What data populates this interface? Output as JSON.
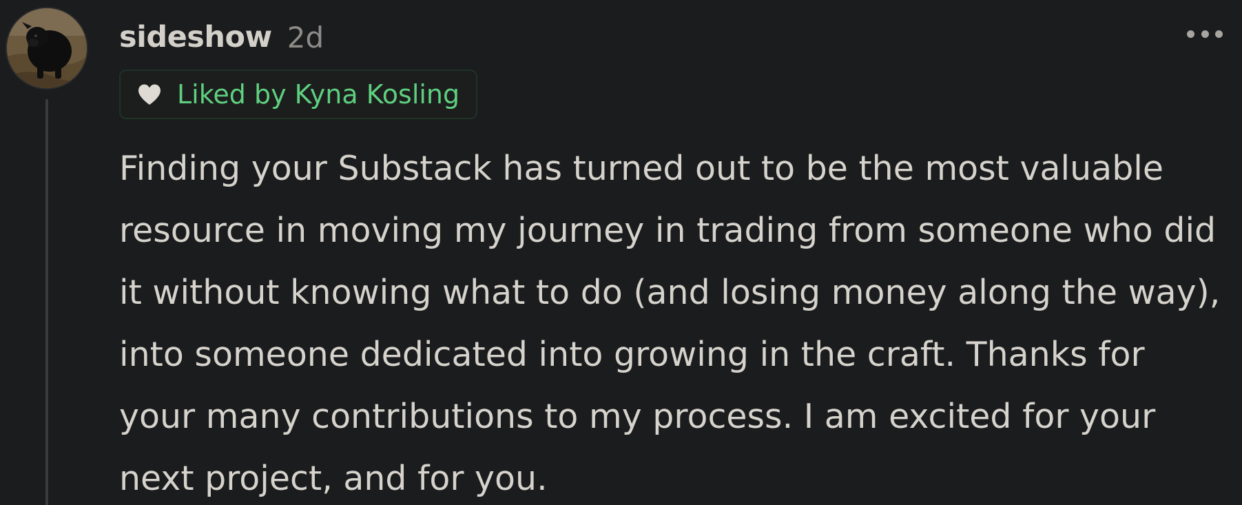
{
  "comment": {
    "username": "sideshow",
    "timestamp": "2d",
    "liked_by": "Liked by Kyna Kosling",
    "body_lines": [
      "Finding your Substack has turned out to be the most valuable",
      "resource in moving my journey in trading from someone who did",
      "it without knowing what to do (and losing money along the way),",
      "into someone dedicated into growing in the craft. Thanks for",
      "your many contributions to my process. I am excited for your",
      "next project, and for you."
    ]
  },
  "icons": {
    "avatar": "dog-photo-avatar",
    "liked": "heart-icon",
    "more": "more-options-icon"
  },
  "colors": {
    "background": "#1b1c1e",
    "text": "#d6d2cc",
    "timestamp": "#8f8c88",
    "liked_accent": "#5fcf7f",
    "thread_line": "#3a3b3d"
  }
}
